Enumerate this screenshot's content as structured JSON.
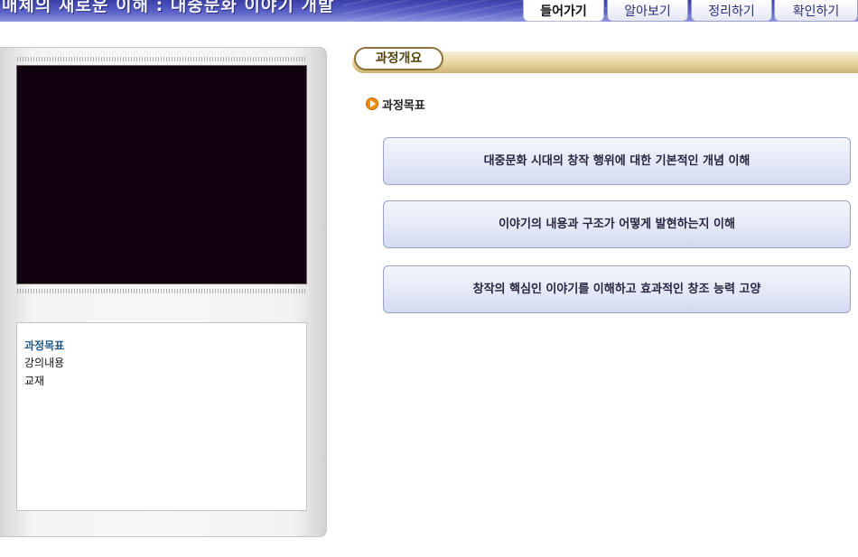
{
  "header": {
    "banner_title": "매체의 새로운 이해 : 대중문화 이야기 개발"
  },
  "tabs": [
    {
      "label": "들어가기",
      "active": true
    },
    {
      "label": "알아보기",
      "active": false
    },
    {
      "label": "정리하기",
      "active": false
    },
    {
      "label": "확인하기",
      "active": false
    }
  ],
  "side_menu": {
    "items": [
      {
        "label": "과정목표",
        "active": true
      },
      {
        "label": "강의내용",
        "active": false
      },
      {
        "label": "교재",
        "active": false
      }
    ]
  },
  "main": {
    "section_label": "과정개요",
    "goal_heading": "과정목표",
    "goals": [
      "대중문화 시대의 창작 행위에 대한 기본적인 개념 이해",
      "이야기의 내용과 구조가 어떻게 발현하는지 이해",
      "창작의 핵심인 이야기를 이해하고 효과적인 창조 능력 고양"
    ]
  },
  "colors": {
    "banner": "#3a3fa8",
    "section_bar": "#e5d39d",
    "goal_box": "#e2e7f6",
    "video_bg": "#12000f",
    "active_menu": "#1f5a8a",
    "goal_icon": "#f08c08"
  },
  "icons": {
    "goal_heading_icon": "orange-circle-arrow-icon"
  }
}
